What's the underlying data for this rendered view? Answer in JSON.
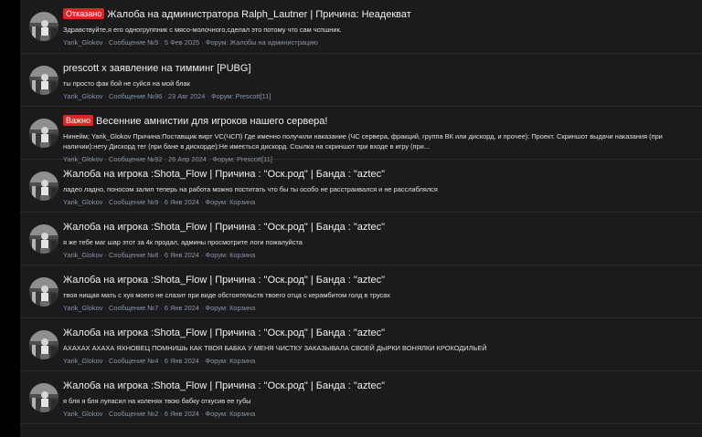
{
  "results": [
    {
      "badge": "Отказано",
      "title": "Жалоба на администратора Ralph_Lautner | Причина: Неадекват",
      "snippet": "Здравствуйте,я его одногруппник с мясо-молочного,сделал это потому что сам чспшник.",
      "author": "Yarik_Glokov",
      "message": "Сообщение №5",
      "date": "5 Фев 2025",
      "forum_label": "Форум:",
      "forum": "Жалобы на администрацию"
    },
    {
      "badge": "",
      "title": "prescott x заявление на тимминг [PUBG]",
      "snippet": "ты просто фак бой не суйся на мой блак",
      "author": "Yarik_Glokov",
      "message": "Сообщение №96",
      "date": "23 Авг 2024",
      "forum_label": "Форум:",
      "forum": "Prescott[11]"
    },
    {
      "badge": "Важно",
      "title": "Весенние амнистии для игроков нашего сервера!",
      "snippet": "Нинейм; Yarik_Glokov Причина:Поставщик вирт VC(ЧСП) Где именно получили наказание (ЧС сервера, фракций, группа ВК или дискорд, и прочее): Проект. Скриншот выдачи наказания (при наличии):нету Дискорд тег (при бане в дискорде):Не имеється дискорд. Ссылка на скриншот при входе в игру (при...",
      "author": "Yarik_Glokov",
      "message": "Сообщение №92",
      "date": "26 Апр 2024",
      "forum_label": "Форум:",
      "forum": "Prescott[11]"
    },
    {
      "badge": "",
      "title": "Жалоба на игрока :Shota_Flow | Причина : \"Оск.род\" | Банда : \"aztec\"",
      "snippet": "ладео ладно, поносом залил теперь на работа можно поститать что бы ты особо не расстраивался и не расслаблялся",
      "author": "Yarik_Glokov",
      "message": "Сообщение №9",
      "date": "6 Янв 2024",
      "forum_label": "Форум:",
      "forum": "Корзина"
    },
    {
      "badge": "",
      "title": "Жалоба на игрока :Shota_Flow | Причина : \"Оск.род\" | Банда : \"aztec\"",
      "snippet": "я же тебе маг шар этот за 4к продал, админы просмотрите логи пожалуйста",
      "author": "Yarik_Glokov",
      "message": "Сообщение №8",
      "date": "6 Янв 2024",
      "forum_label": "Форум:",
      "forum": "Корзина"
    },
    {
      "badge": "",
      "title": "Жалоба на игрока :Shota_Flow | Причина : \"Оск.род\" | Банда : \"aztec\"",
      "snippet": "твоя нищая мать с хуя моего не слазит при виде обстоятельств твоего отца с керамбитом голд в трусах",
      "author": "Yarik_Glokov",
      "message": "Сообщение №7",
      "date": "6 Янв 2024",
      "forum_label": "Форум:",
      "forum": "Корзина"
    },
    {
      "badge": "",
      "title": "Жалоба на игрока :Shota_Flow | Причина : \"Оск.род\" | Банда : \"aztec\"",
      "snippet": "АХАХАХ АХАХА ЯХНОВЕЦ ПОМНИШЬ КАК ТВОЯ БАБКА У МЕНЯ ЧИСТКУ ЗАКАЗЫВАЛА СВОЕЙ ДЫРКИ ВОНЯЛКИ КРОКОДИЛЬЕЙ",
      "author": "Yarik_Glokov",
      "message": "Сообщение №4",
      "date": "6 Янв 2024",
      "forum_label": "Форум:",
      "forum": "Корзина"
    },
    {
      "badge": "",
      "title": "Жалоба на игрока :Shota_Flow | Причина : \"Оск.род\" | Банда : \"aztec\"",
      "snippet": "я бля я бля лупасил на коленях твою бабку откусив ее губы",
      "author": "Yarik_Glokov",
      "message": "Сообщение №2",
      "date": "6 Янв 2024",
      "forum_label": "Форум:",
      "forum": "Корзина"
    }
  ],
  "separator": "·",
  "colors": {
    "background": "#1b1b1b",
    "badge": "#e02424",
    "meta": "#8a95a6"
  }
}
